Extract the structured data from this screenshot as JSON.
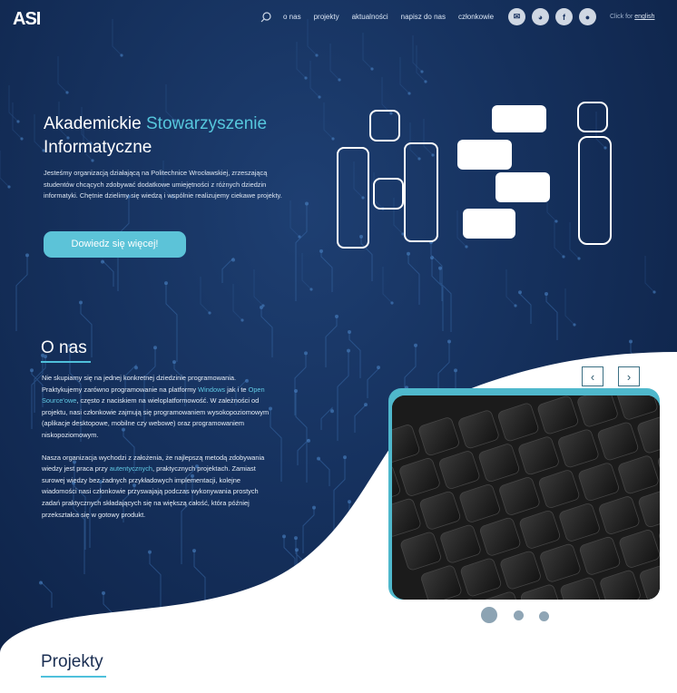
{
  "nav": {
    "logo": "ASI",
    "links": [
      "o nas",
      "projekty",
      "aktualności",
      "napisz do nas",
      "członkowie"
    ],
    "socials": [
      "mail-icon",
      "discord-icon",
      "facebook-icon",
      "github-icon"
    ],
    "lang_prefix": "Click for",
    "lang_link": "english"
  },
  "hero": {
    "title_part1": "Akademickie",
    "title_accent": "Stowarzyszenie",
    "title_part2": "Informatyczne",
    "description": "Jesteśmy organizacją działającą na Politechnice Wrocławskiej, zrzeszającą studentów chcących zdobywać dodatkowe umiejętności z różnych dziedzin informatyki. Chętnie dzielimy się wiedzą i wspólnie realizujemy ciekawe projekty.",
    "button": "Dowiedz się więcej!"
  },
  "about": {
    "title": "O nas",
    "p1_a": "Nie skupiamy się na jednej konkretnej dziedzinie programowania. Praktykujemy zarówno programowanie na platformy ",
    "p1_hl1": "Windows",
    "p1_b": " jak i te ",
    "p1_hl2": "Open Source'owe",
    "p1_c": ", często z naciskiem na wieloplatformowość. W zależności od projektu, nasi członkowie zajmują się programowaniem wysokopoziomowym (aplikacje desktopowe, mobilne czy webowe) oraz programowaniem niskopoziomowym.",
    "p2_a": "Nasza organizacja wychodzi z założenia, że najlepszą metodą zdobywania wiedzy jest praca przy ",
    "p2_hl": "autentycznych",
    "p2_b": ", praktycznych projektach. Zamiast surowej wiedzy bez żadnych przykładowych implementacji, kolejne wiadomości nasi członkowie przyswajają podczas wykonywania prostych zadań praktycznych składających się na większą całość, która później przekształca się w gotowy produkt."
  },
  "slider": {
    "prev": "‹",
    "next": "›",
    "dots": 3,
    "active_dot": 0
  },
  "projects": {
    "title": "Projekty"
  },
  "colors": {
    "accent": "#56c6dc",
    "navy": "#15305c",
    "dark_text": "#1a2e52"
  }
}
